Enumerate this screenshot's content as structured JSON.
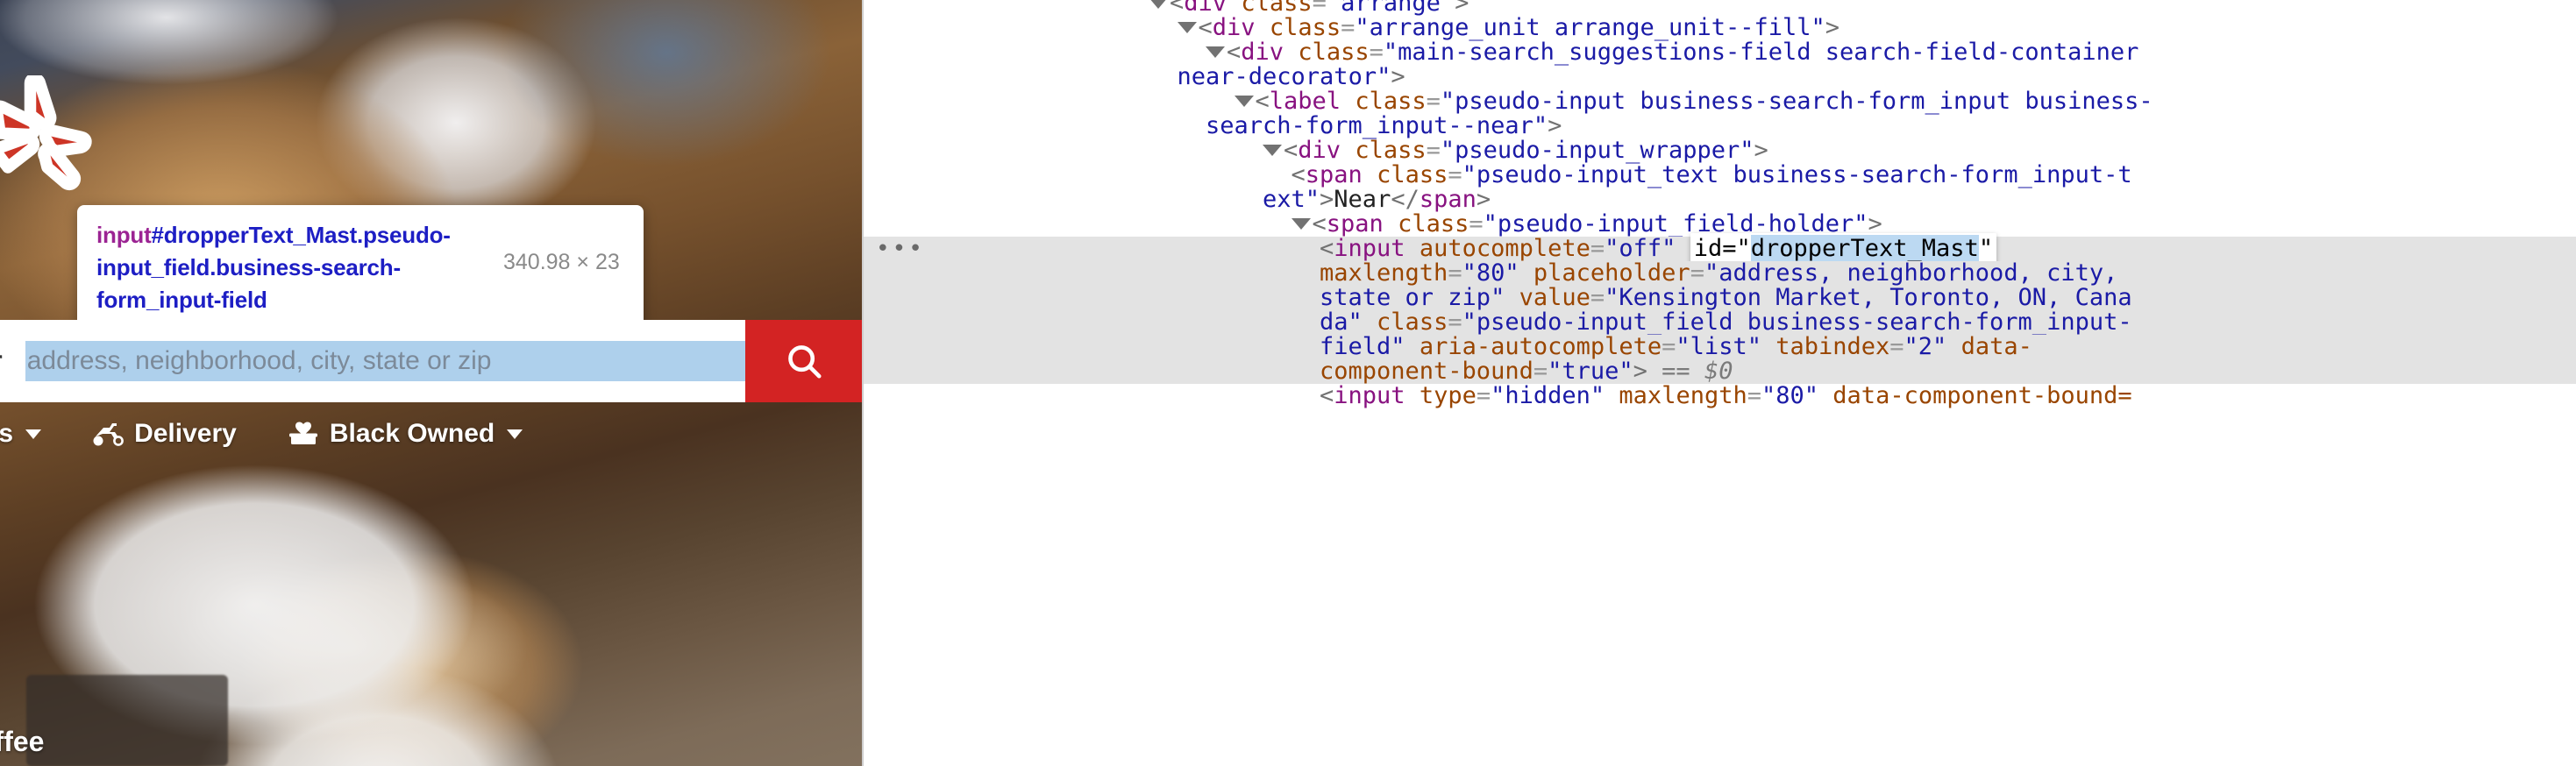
{
  "page": {
    "logo": "yelp-burst-logo",
    "search": {
      "near_label": "Near",
      "near_placeholder": "address, neighborhood, city, state or zip",
      "search_button_icon": "search-icon"
    },
    "nav_items": [
      {
        "label": "vices",
        "icon": "",
        "caret": true
      },
      {
        "label": "Delivery",
        "icon": "scooter-icon",
        "caret": false
      },
      {
        "label": "Black Owned",
        "icon": "black-owned-icon",
        "caret": true
      }
    ],
    "footnote": "offee"
  },
  "inspector_tooltip": {
    "tag": "input",
    "selector_rest": "#dropperText_Mast.pseudo-input_field.business-search-form_input-field",
    "dimensions": "340.98 × 23"
  },
  "devtools": {
    "lines": [
      {
        "indent": 20,
        "triangle": true,
        "tokens": [
          {
            "t": "<",
            "c": "tw"
          },
          {
            "t": "div",
            "c": "tag"
          },
          {
            "t": " ",
            "c": "tw"
          },
          {
            "t": "class",
            "c": "attr"
          },
          {
            "t": "=",
            "c": "eqg"
          },
          {
            "t": "\"arrange\"",
            "c": "val"
          },
          {
            "t": ">",
            "c": "tw"
          }
        ]
      },
      {
        "indent": 22,
        "triangle": true,
        "tokens": [
          {
            "t": "<",
            "c": "tw"
          },
          {
            "t": "div",
            "c": "tag"
          },
          {
            "t": " ",
            "c": "tw"
          },
          {
            "t": "class",
            "c": "attr"
          },
          {
            "t": "=",
            "c": "eqg"
          },
          {
            "t": "\"arrange_unit arrange_unit--fill\"",
            "c": "val"
          },
          {
            "t": ">",
            "c": "tw"
          }
        ]
      },
      {
        "indent": 24,
        "triangle": true,
        "tokens": [
          {
            "t": "<",
            "c": "tw"
          },
          {
            "t": "div",
            "c": "tag"
          },
          {
            "t": " ",
            "c": "tw"
          },
          {
            "t": "class",
            "c": "attr"
          },
          {
            "t": "=",
            "c": "eqg"
          },
          {
            "t": "\"main-search_suggestions-field search-field-container",
            "c": "val"
          }
        ]
      },
      {
        "indent": 22,
        "triangle": false,
        "tokens": [
          {
            "t": "near-decorator\"",
            "c": "val"
          },
          {
            "t": ">",
            "c": "tw"
          }
        ]
      },
      {
        "indent": 26,
        "triangle": true,
        "tokens": [
          {
            "t": "<",
            "c": "tw"
          },
          {
            "t": "label",
            "c": "tag"
          },
          {
            "t": " ",
            "c": "tw"
          },
          {
            "t": "class",
            "c": "attr"
          },
          {
            "t": "=",
            "c": "eqg"
          },
          {
            "t": "\"pseudo-input business-search-form_input business-",
            "c": "val"
          }
        ]
      },
      {
        "indent": 24,
        "triangle": false,
        "tokens": [
          {
            "t": "search-form_input--near\"",
            "c": "val"
          },
          {
            "t": ">",
            "c": "tw"
          }
        ]
      },
      {
        "indent": 28,
        "triangle": true,
        "tokens": [
          {
            "t": "<",
            "c": "tw"
          },
          {
            "t": "div",
            "c": "tag"
          },
          {
            "t": " ",
            "c": "tw"
          },
          {
            "t": "class",
            "c": "attr"
          },
          {
            "t": "=",
            "c": "eqg"
          },
          {
            "t": "\"pseudo-input_wrapper\"",
            "c": "val"
          },
          {
            "t": ">",
            "c": "tw"
          }
        ]
      },
      {
        "indent": 30,
        "triangle": false,
        "tokens": [
          {
            "t": "<",
            "c": "tw"
          },
          {
            "t": "span",
            "c": "tag"
          },
          {
            "t": " ",
            "c": "tw"
          },
          {
            "t": "class",
            "c": "attr"
          },
          {
            "t": "=",
            "c": "eqg"
          },
          {
            "t": "\"pseudo-input_text business-search-form_input-t",
            "c": "val"
          }
        ]
      },
      {
        "indent": 28,
        "triangle": false,
        "tokens": [
          {
            "t": "ext\"",
            "c": "val"
          },
          {
            "t": ">",
            "c": "tw"
          },
          {
            "t": "Near",
            "c": "txt"
          },
          {
            "t": "</",
            "c": "tw"
          },
          {
            "t": "span",
            "c": "tag"
          },
          {
            "t": ">",
            "c": "tw"
          }
        ]
      },
      {
        "indent": 30,
        "triangle": true,
        "tokens": [
          {
            "t": "<",
            "c": "tw"
          },
          {
            "t": "span",
            "c": "tag"
          },
          {
            "t": " ",
            "c": "tw"
          },
          {
            "t": "class",
            "c": "attr"
          },
          {
            "t": "=",
            "c": "eqg"
          },
          {
            "t": "\"pseudo-input_field-holder\"",
            "c": "val"
          },
          {
            "t": ">",
            "c": "tw"
          }
        ]
      },
      {
        "indent": 32,
        "triangle": false,
        "selected": true,
        "dots": true,
        "tokens": [
          {
            "t": "<",
            "c": "tw"
          },
          {
            "t": "input",
            "c": "tag"
          },
          {
            "t": " ",
            "c": "tw"
          },
          {
            "t": "autocomplete",
            "c": "attr"
          },
          {
            "t": "=",
            "c": "eqg"
          },
          {
            "t": "\"off\"",
            "c": "val"
          },
          {
            "t": " ",
            "c": "tw"
          },
          {
            "t": "EDITCHIP",
            "c": "chip"
          }
        ],
        "chip": {
          "prefix": "id=\"",
          "picked": "dropperText_Mast",
          "suffix": "\""
        }
      },
      {
        "indent": 32,
        "triangle": false,
        "selected": true,
        "tokens": [
          {
            "t": "maxlength",
            "c": "attr"
          },
          {
            "t": "=",
            "c": "eqg"
          },
          {
            "t": "\"80\"",
            "c": "val"
          },
          {
            "t": " ",
            "c": "tw"
          },
          {
            "t": "placeholder",
            "c": "attr"
          },
          {
            "t": "=",
            "c": "eqg"
          },
          {
            "t": "\"address, neighborhood, city,",
            "c": "val"
          }
        ]
      },
      {
        "indent": 32,
        "triangle": false,
        "selected": true,
        "tokens": [
          {
            "t": "state or zip\"",
            "c": "val"
          },
          {
            "t": " ",
            "c": "tw"
          },
          {
            "t": "value",
            "c": "attr"
          },
          {
            "t": "=",
            "c": "eqg"
          },
          {
            "t": "\"Kensington Market, Toronto, ON, Cana",
            "c": "val"
          }
        ]
      },
      {
        "indent": 32,
        "triangle": false,
        "selected": true,
        "tokens": [
          {
            "t": "da\"",
            "c": "val"
          },
          {
            "t": " ",
            "c": "tw"
          },
          {
            "t": "class",
            "c": "attr"
          },
          {
            "t": "=",
            "c": "eqg"
          },
          {
            "t": "\"pseudo-input_field business-search-form_input-",
            "c": "val"
          }
        ]
      },
      {
        "indent": 32,
        "triangle": false,
        "selected": true,
        "tokens": [
          {
            "t": "field\"",
            "c": "val"
          },
          {
            "t": " ",
            "c": "tw"
          },
          {
            "t": "aria-autocomplete",
            "c": "attr"
          },
          {
            "t": "=",
            "c": "eqg"
          },
          {
            "t": "\"list\"",
            "c": "val"
          },
          {
            "t": " ",
            "c": "tw"
          },
          {
            "t": "tabindex",
            "c": "attr"
          },
          {
            "t": "=",
            "c": "eqg"
          },
          {
            "t": "\"2\"",
            "c": "val"
          },
          {
            "t": " ",
            "c": "tw"
          },
          {
            "t": "data-",
            "c": "attr"
          }
        ]
      },
      {
        "indent": 32,
        "triangle": false,
        "selected": true,
        "tokens": [
          {
            "t": "component-bound",
            "c": "attr"
          },
          {
            "t": "=",
            "c": "eqg"
          },
          {
            "t": "\"true\"",
            "c": "val"
          },
          {
            "t": ">",
            "c": "tw"
          },
          {
            "t": " == ",
            "c": "eqeq"
          },
          {
            "t": "$0",
            "c": "dollar"
          }
        ]
      },
      {
        "indent": 32,
        "triangle": false,
        "tokens": [
          {
            "t": "<",
            "c": "tw"
          },
          {
            "t": "input",
            "c": "tag"
          },
          {
            "t": " ",
            "c": "tw"
          },
          {
            "t": "type",
            "c": "attr"
          },
          {
            "t": "=",
            "c": "eqg"
          },
          {
            "t": "\"hidden\"",
            "c": "val"
          },
          {
            "t": " ",
            "c": "tw"
          },
          {
            "t": "maxlength",
            "c": "attr"
          },
          {
            "t": "=",
            "c": "eqg"
          },
          {
            "t": "\"80\"",
            "c": "val"
          },
          {
            "t": " ",
            "c": "tw"
          },
          {
            "t": "data-component-bound=",
            "c": "attr"
          }
        ]
      }
    ]
  },
  "colors": {
    "brand_red": "#d32323",
    "tag_purple": "#881280",
    "attr_orange": "#994500",
    "value_blue": "#1a1aa6",
    "selection_blue": "#aed0ec",
    "devtools_selected_row": "#e3e3e3"
  }
}
